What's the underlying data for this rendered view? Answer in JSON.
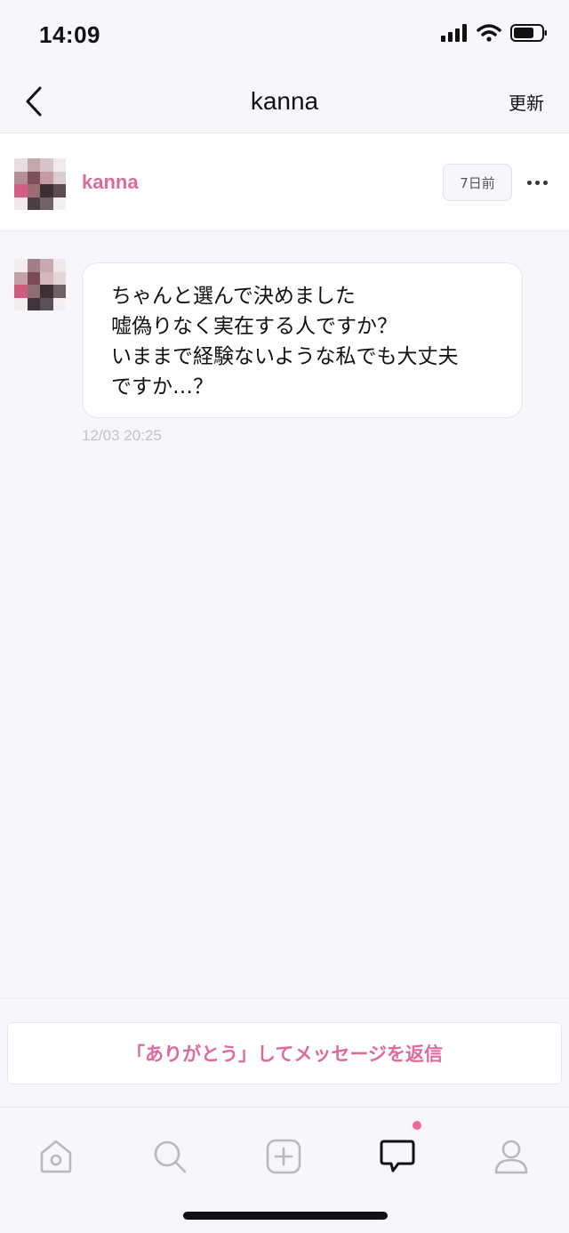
{
  "status_bar": {
    "time": "14:09"
  },
  "nav": {
    "title": "kanna",
    "refresh_label": "更新"
  },
  "partner": {
    "name": "kanna",
    "last_active": "7日前"
  },
  "message": {
    "lines": [
      "ちゃんと選んで決めました",
      "嘘偽りなく実在する人ですか？",
      "いままで経験ないような私でも大丈夫",
      "ですか…？"
    ],
    "timestamp": "12/03 20:25"
  },
  "reply": {
    "label": "「ありがとう」してメッセージを返信"
  },
  "tabs": [
    {
      "icon": "home-icon"
    },
    {
      "icon": "search-icon"
    },
    {
      "icon": "plus-icon"
    },
    {
      "icon": "chat-icon",
      "active": true,
      "has_badge": true
    },
    {
      "icon": "profile-icon"
    }
  ],
  "colors": {
    "accent": "#e0699b",
    "badge": "#ef6a96",
    "background": "#f7f6fb"
  }
}
